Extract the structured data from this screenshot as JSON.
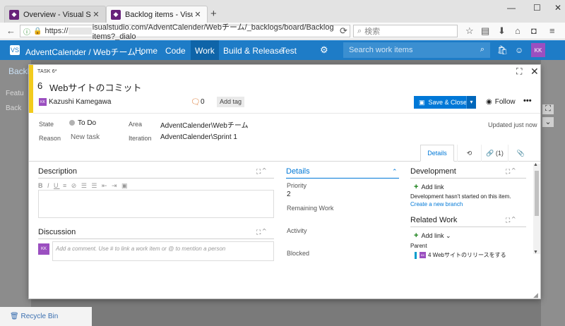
{
  "browser": {
    "tabs": [
      {
        "title": "Overview - Visual Studio T…",
        "close": "✕"
      },
      {
        "title": "Backlog items - Visual Studio…",
        "close": "✕"
      }
    ],
    "new_tab": "+",
    "window": {
      "minimize": "—",
      "maximize": "☐",
      "close": "✕"
    },
    "url_prefix": "https://",
    "url_rest": "isualstudio.com/AdventCalender/Webチーム/_backlogs/board/Backlog items?_dialo",
    "search_placeholder": "検索",
    "icons": {
      "back": "←",
      "reload": "⟳",
      "lock": "🔒",
      "info": "ⓘ",
      "star": "☆",
      "reader": "▤",
      "download": "⬇",
      "home": "⌂",
      "pocket": "◘",
      "menu": "≡"
    }
  },
  "vsts": {
    "project": "AdventCalender / Webチーム ⌄",
    "nav": [
      "Home",
      "Code",
      "Work",
      "Build & Release",
      "Test"
    ],
    "active_nav": "Work",
    "search_placeholder": "Search work items",
    "avatar": "KK",
    "icons": {
      "logo": "VS",
      "gear": "⚙",
      "search": "⌕",
      "bag": "🛍",
      "smile": "☺"
    }
  },
  "background": {
    "backlog_tab": "Backlog",
    "items": [
      "Featu",
      "Back"
    ],
    "recycle_bin": "Recycle Bin",
    "icons": {
      "expand": "⛶",
      "chevron": "⌄"
    }
  },
  "workitem": {
    "type_label": "TASK 6*",
    "id": "6",
    "title": "Webサイトのコミット",
    "assignee": "Kazushi Kamegawa",
    "assignee_initials": "KK",
    "comment_count": "0",
    "add_tag": "Add tag",
    "save_close": "Save & Close",
    "follow": "Follow",
    "more": "•••",
    "fields": {
      "state_label": "State",
      "state_value": "To Do",
      "reason_label": "Reason",
      "reason_value": "New task",
      "area_label": "Area",
      "area_value": "AdventCalender\\Webチーム",
      "iteration_label": "Iteration",
      "iteration_value": "AdventCalender\\Sprint 1"
    },
    "updated": "Updated just now",
    "tabs": {
      "details": "Details",
      "links": "(1)"
    },
    "description_title": "Description",
    "discussion_title": "Discussion",
    "discussion_placeholder": "Add a comment. Use # to link a work item or @ to mention a person",
    "details_title": "Details",
    "priority_label": "Priority",
    "priority_value": "2",
    "remaining_label": "Remaining Work",
    "activity_label": "Activity",
    "blocked_label": "Blocked",
    "development_title": "Development",
    "add_link": "Add link",
    "dev_text": "Development hasn't started on this item.",
    "create_branch": "Create a new branch",
    "related_title": "Related Work",
    "related_add_link": "Add link ⌄",
    "parent_label": "Parent",
    "parent_item": "4 Webサイトのリリースをする",
    "icons": {
      "expand": "⛶",
      "close": "✕",
      "comment": "🗨",
      "save": "💾",
      "drop": "▾",
      "eye": "👁",
      "history": "⟲",
      "link": "🔗",
      "attach": "📎",
      "collapse": "⌃",
      "scroll_up": "▲",
      "scroll_down": "▼",
      "grip": "◢"
    },
    "editor_toolbar": [
      "B",
      "I",
      "U",
      "≡",
      "🔗",
      "☰",
      "☰",
      "⇤",
      "⇥",
      "▣"
    ]
  },
  "colors": {
    "accent": "#0078d7",
    "header": "#1e7cc7",
    "task_yellow": "#f2cb1d",
    "avatar": "#9b4fc0"
  }
}
